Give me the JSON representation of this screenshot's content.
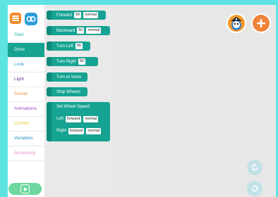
{
  "sidebar": {
    "categories": [
      {
        "label": "Start",
        "color": "#2bb3a0"
      },
      {
        "label": "Drive",
        "color": "#ffffff"
      },
      {
        "label": "Look",
        "color": "#2d9cdb"
      },
      {
        "label": "Light",
        "color": "#6a3fa0"
      },
      {
        "label": "Sound",
        "color": "#f0913a"
      },
      {
        "label": "Animations",
        "color": "#9b3fb8"
      },
      {
        "label": "Control",
        "color": "#e3c532"
      },
      {
        "label": "Variables",
        "color": "#2a8fc6"
      },
      {
        "label": "Accessory",
        "color": "#ee7fcf"
      }
    ],
    "selected_index": 1
  },
  "palette": {
    "forward": {
      "label": "Forward",
      "value": "50",
      "speed": "normal"
    },
    "backward": {
      "label": "Backward",
      "value": "50",
      "speed": "normal"
    },
    "turn_left": {
      "label": "Turn Left",
      "value": "90"
    },
    "turn_right": {
      "label": "Turn Right",
      "value": "90"
    },
    "turn_to_voice": {
      "label": "Turn to Voice"
    },
    "stop_wheels": {
      "label": "Stop Wheels"
    },
    "set_wheel_speed": {
      "label": "Set Wheel Speed",
      "left_label": "Left",
      "left_direction": "forward",
      "left_speed": "normal",
      "right_label": "Right",
      "right_direction": "forward",
      "right_speed": "normal"
    }
  },
  "icons": {
    "menu": "menu-icon",
    "logo": "app-logo-icon",
    "play": "play-icon",
    "avatar": "robot-avatar",
    "add": "plus-icon",
    "redo": "redo-icon",
    "undo": "undo-icon"
  },
  "colors": {
    "block": "#16a392",
    "accent": "#f0833a",
    "background": "#5ee3e3"
  }
}
